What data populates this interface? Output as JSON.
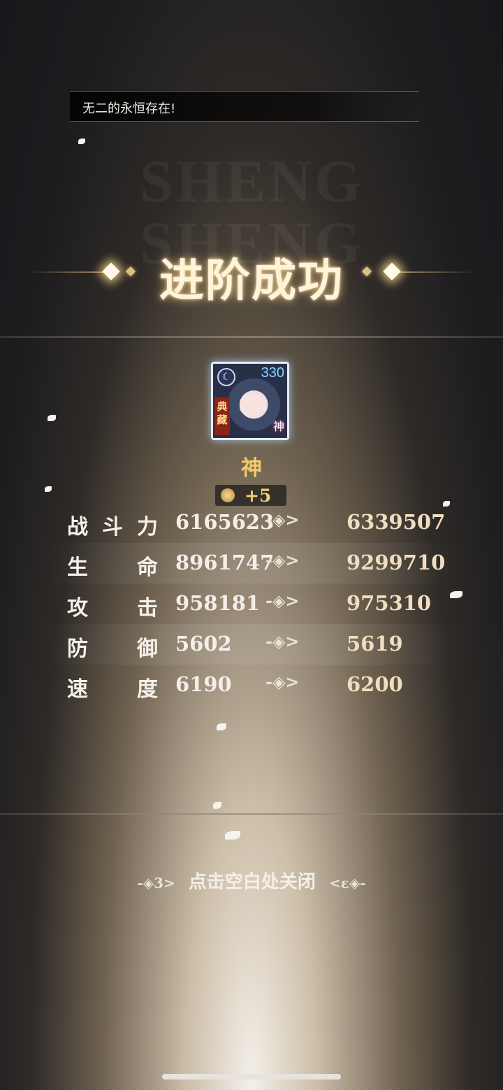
{
  "top_message": "无二的永恒存在!",
  "watermark": "SHENG\nSHENG",
  "title": "进阶成功",
  "hero": {
    "level": "330",
    "tag": "典藏",
    "tier_badge": "神",
    "moon_icon": "moon-icon"
  },
  "rank_label": "神",
  "upgrade_badge": {
    "icon": "coin-icon",
    "text": "+5"
  },
  "stats": [
    {
      "label": [
        "战",
        "斗",
        "力"
      ],
      "before": "6165623",
      "arrow": "-◈>",
      "after": "6339507"
    },
    {
      "label": [
        "生",
        "命"
      ],
      "before": "8961747",
      "arrow": "-◈>",
      "after": "9299710"
    },
    {
      "label": [
        "攻",
        "击"
      ],
      "before": "958181",
      "arrow": "-◈>",
      "after": "975310"
    },
    {
      "label": [
        "防",
        "御"
      ],
      "before": "5602",
      "arrow": "-◈>",
      "after": "5619"
    },
    {
      "label": [
        "速",
        "度"
      ],
      "before": "6190",
      "arrow": "-◈>",
      "after": "6200"
    }
  ],
  "close_hint": "点击空白处关闭",
  "close_deco_left": "-◈3>",
  "close_deco_right": "<ε◈-",
  "colors": {
    "gold": "#f4ca6d",
    "glow": "#ffd28c"
  }
}
